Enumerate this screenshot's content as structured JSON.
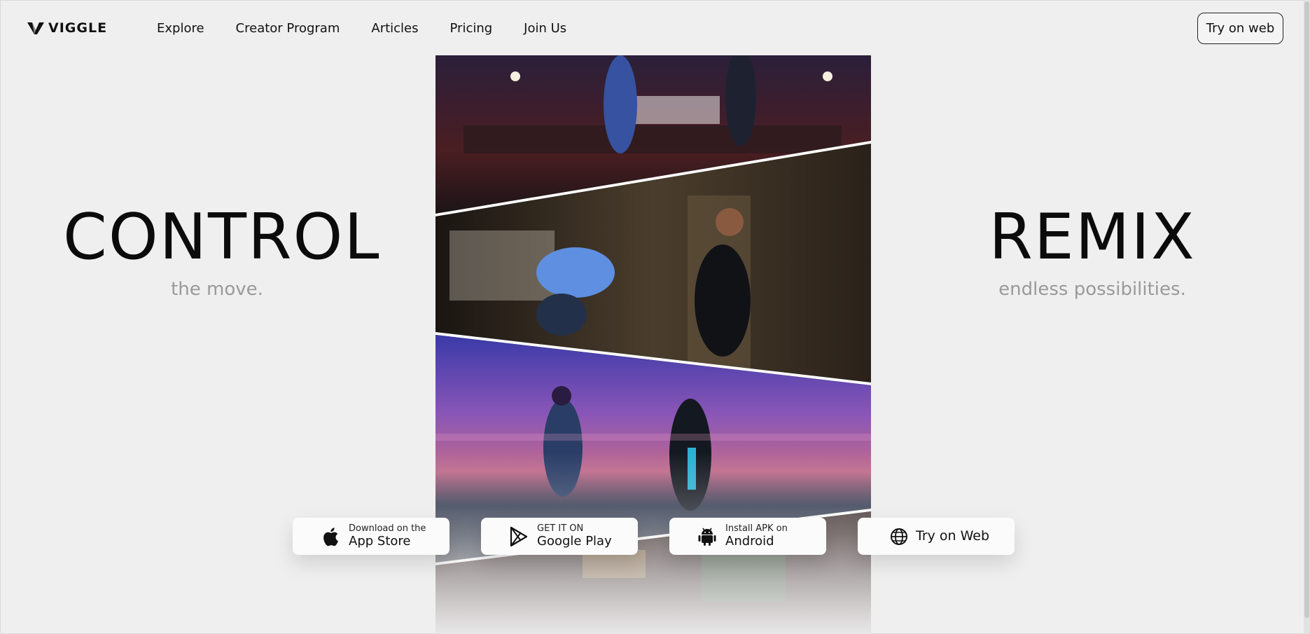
{
  "brand": {
    "name": "VIGGLE",
    "logo_icon": "viggle-v-logo-icon"
  },
  "nav": {
    "items": [
      {
        "label": "Explore"
      },
      {
        "label": "Creator Program"
      },
      {
        "label": "Articles"
      },
      {
        "label": "Pricing"
      },
      {
        "label": "Join Us"
      }
    ],
    "cta_label": "Try on web"
  },
  "hero": {
    "left_title": "CONTROL",
    "left_subtitle": "the move.",
    "right_title": "REMIX",
    "right_subtitle": "endless possibilities."
  },
  "downloads": [
    {
      "small": "Download on the",
      "big": "App Store",
      "icon": "apple-icon"
    },
    {
      "small": "GET IT ON",
      "big": "Google Play",
      "icon": "google-play-icon"
    },
    {
      "small": "Install APK on",
      "big": "Android",
      "icon": "android-icon"
    },
    {
      "small": "",
      "big": "Try on Web",
      "icon": "globe-icon"
    }
  ],
  "colors": {
    "background": "#efefef",
    "text": "#111111",
    "subtitle": "#9a9a9a",
    "button_bg": "#fbfbfb"
  }
}
